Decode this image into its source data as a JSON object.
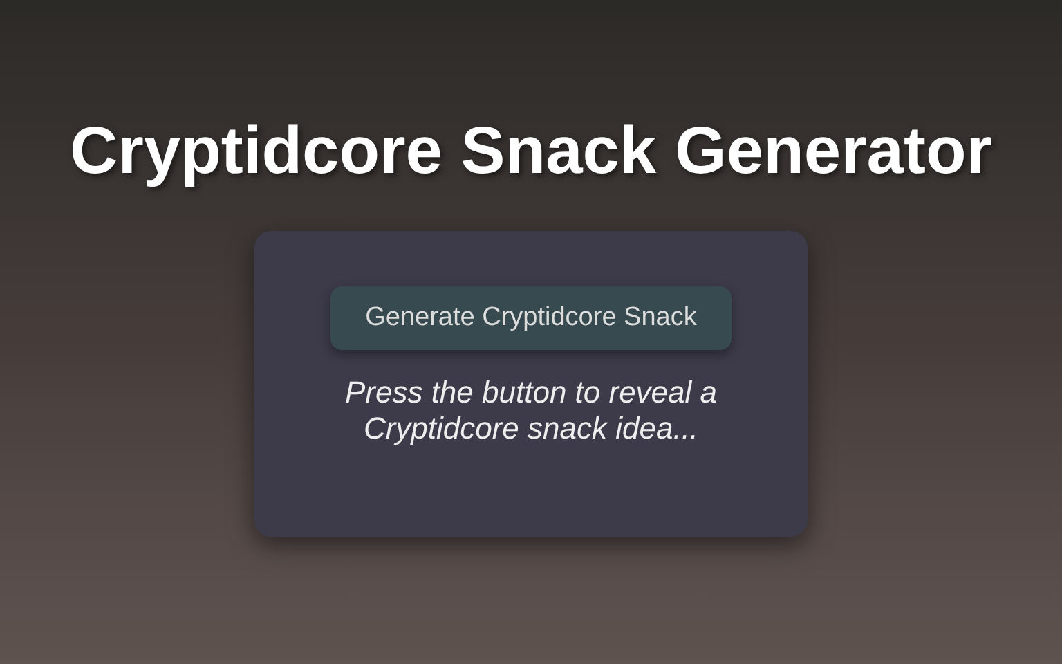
{
  "title": "Cryptidcore Snack Generator",
  "card": {
    "button": "Generate Cryptidcore Snack",
    "message": "Press the button to reveal a Cryptidcore snack idea..."
  }
}
